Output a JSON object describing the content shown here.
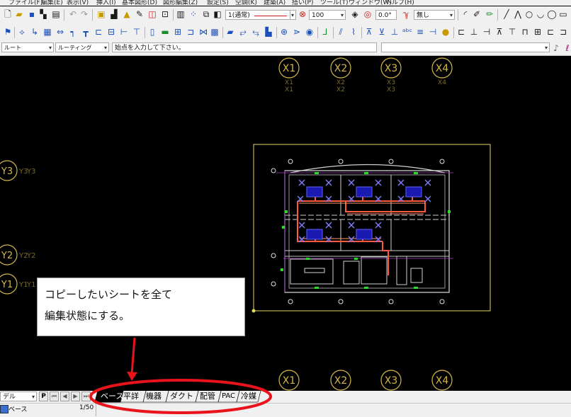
{
  "menu": {
    "items": [
      "ファイル(F)",
      "編集(E)",
      "表示(V)",
      "挿入(I)",
      "基本図形(D)",
      "図形編集(Z)",
      "設定(S)",
      "空調(K)",
      "建築(A)",
      "搭い(P)",
      "ツール(T)",
      "ウィンドウ(W)",
      "ヘルプ(H)"
    ]
  },
  "toolbar1": {
    "layer_combo": "1(通常)",
    "scale_value": "100",
    "angle_value": "0.0°",
    "line_combo": "無し"
  },
  "toolbar3": {
    "route_combo": "ルート",
    "routing_combo": "ルーティング",
    "prompt_text": "始点を入力して下さい。",
    "right_combo": ""
  },
  "drawing": {
    "grid_x_labels": [
      "X1",
      "X2",
      "X3",
      "X4"
    ],
    "grid_y_labels": [
      "Y3",
      "Y2",
      "Y1"
    ],
    "colors": {
      "background": "#000000",
      "grid": "#d4b84a",
      "frame": "#e6d860",
      "walls": "#e0e0e0",
      "duct": "#ff5a3c",
      "unit": "#2a2ad8",
      "green": "#2adc2a",
      "purple": "#c060e0"
    }
  },
  "callout": {
    "line1": "コピーしたいシートを全て",
    "line2": "編集状態にする。"
  },
  "annotation": {
    "ellipse_color": "#e8131b",
    "arrow_color": "#e8131b"
  },
  "bottom": {
    "model_combo": "デル",
    "p_button": "P",
    "sheet_tabs": [
      "ベース",
      "平詳",
      "機器",
      "ダクト",
      "配管",
      "PAC",
      "冷媒"
    ],
    "active_tab": "ベース",
    "status_sheet": "ベース",
    "status_scale": "1/50"
  }
}
